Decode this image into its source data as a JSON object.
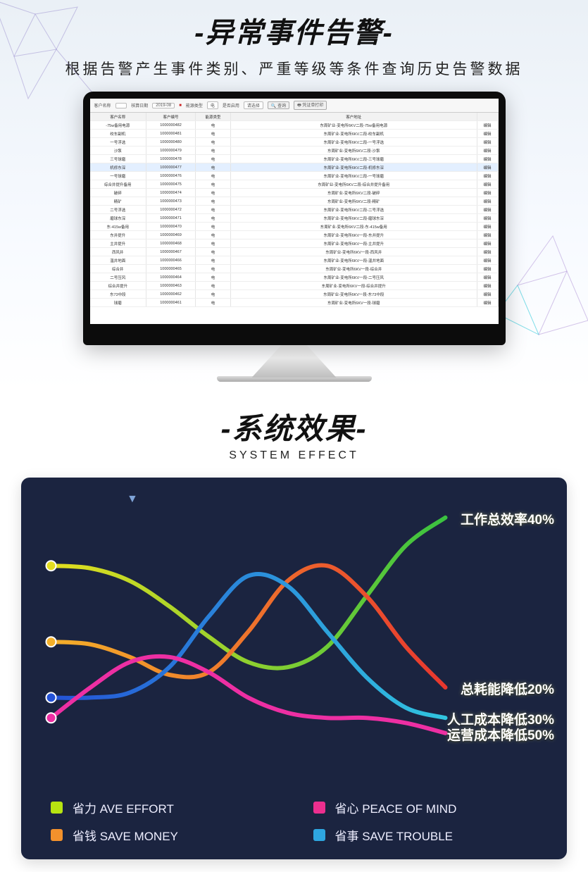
{
  "section1": {
    "title": "-异常事件告警-",
    "subtitle": "根据告警产生事件类别、严重等级等条件查询历史告警数据",
    "toolbar": {
      "name_label": "客户名称",
      "date_label": "核算日期",
      "date_value": "2019-08",
      "energy_label": "能源类型",
      "energy_value": "电",
      "use_label": "是否启用",
      "use_value": "请选择",
      "search_btn": "查询",
      "print_btn": "凭证单打印"
    },
    "columns": [
      "客户名称",
      "客户编号",
      "能源类型",
      "客户地址",
      ""
    ],
    "rows": [
      {
        "name": "-75w备用电源",
        "code": "1000000482",
        "type": "电",
        "addr": "东周矿业-变电所6KV二段-75w备用电源",
        "op": "编辑"
      },
      {
        "name": "绞车副机",
        "code": "1000000481",
        "type": "电",
        "addr": "东周矿业-变电所6KV二段-绞车副机",
        "op": "编辑"
      },
      {
        "name": "一号浮选",
        "code": "1000000480",
        "type": "电",
        "addr": "东周矿业-变电所6KV二段-一号浮选",
        "op": "编辑"
      },
      {
        "name": "沙泵",
        "code": "1000000479",
        "type": "电",
        "addr": "东周矿业-变电所6KV二段-沙泵",
        "op": "编辑"
      },
      {
        "name": "三号球磨",
        "code": "1000000478",
        "type": "电",
        "addr": "东周矿业-变电所6KV二段-三号球磨",
        "op": "编辑"
      },
      {
        "name": "机修东深",
        "code": "1000000477",
        "type": "电",
        "addr": "东周矿业-变电所6KV二段-机修东深",
        "op": "编辑",
        "sel": true
      },
      {
        "name": "一号球磨",
        "code": "1000000476",
        "type": "电",
        "addr": "东周矿业-变电所6KV二段-一号球磨",
        "op": "编辑"
      },
      {
        "name": "综合井提升备用",
        "code": "1000000475",
        "type": "电",
        "addr": "东周矿业-变电所6KV二段-综合井提升备用",
        "op": "编辑"
      },
      {
        "name": "破碎",
        "code": "1000000474",
        "type": "电",
        "addr": "东周矿业-变电所6KV二段-破碎",
        "op": "编辑"
      },
      {
        "name": "精矿",
        "code": "1000000473",
        "type": "电",
        "addr": "东周矿业-变电所6KV二段-精矿",
        "op": "编辑"
      },
      {
        "name": "二号浮选",
        "code": "1000000472",
        "type": "电",
        "addr": "东周矿业-变电所6KV二段-二号浮选",
        "op": "编辑"
      },
      {
        "name": "磨球东深",
        "code": "1000000471",
        "type": "电",
        "addr": "东周矿业-变电所6KV二段-磨球东深",
        "op": "编辑"
      },
      {
        "name": "东-415w备用",
        "code": "1000000470",
        "type": "电",
        "addr": "东周矿业-变电所6KV二段-东-415w备用",
        "op": "编辑"
      },
      {
        "name": "东井提升",
        "code": "1000000469",
        "type": "电",
        "addr": "东周矿业-变电所6KV一段-东井提升",
        "op": "编辑"
      },
      {
        "name": "主井提升",
        "code": "1000000468",
        "type": "电",
        "addr": "东周矿业-变电所6KV一段-主井提升",
        "op": "编辑"
      },
      {
        "name": "西风井",
        "code": "1000000467",
        "type": "电",
        "addr": "东周矿业-变电所6KV一段-西风井",
        "op": "编辑"
      },
      {
        "name": "温井地面",
        "code": "1000000466",
        "type": "电",
        "addr": "东周矿业-变电所6KV一段-温井地面",
        "op": "编辑"
      },
      {
        "name": "综合井",
        "code": "1000000465",
        "type": "电",
        "addr": "东周矿业-变电所6KV一段-综合井",
        "op": "编辑"
      },
      {
        "name": "二号压风",
        "code": "1000000464",
        "type": "电",
        "addr": "东周矿业-变电所6KV一段-二号压风",
        "op": "编辑"
      },
      {
        "name": "综合井提升",
        "code": "1000000463",
        "type": "电",
        "addr": "东周矿业-变电所6KV一段-综合井提升",
        "op": "编辑"
      },
      {
        "name": "东73中段",
        "code": "1000000462",
        "type": "电",
        "addr": "东周矿业-变电所6KV一段-东73中段",
        "op": "编辑"
      },
      {
        "name": "球磨",
        "code": "1000000461",
        "type": "电",
        "addr": "东周矿业-变电所6KV一段-球磨",
        "op": "编辑"
      }
    ]
  },
  "section2": {
    "title": "-系统效果-",
    "subtitle": "SYSTEM EFFECT",
    "legend": [
      {
        "label": "省力 AVE EFFORT",
        "color": "#b7e411"
      },
      {
        "label": "省心 PEACE OF MIND",
        "color": "#ec2f8f"
      },
      {
        "label": "省钱 SAVE MONEY",
        "color": "#f3912c"
      },
      {
        "label": "省事 SAVE TROUBLE",
        "color": "#2ea6e0"
      }
    ],
    "end_labels": [
      {
        "text": "工作总效率40%",
        "color": "#6fd33a"
      },
      {
        "text": "总耗能降低20%",
        "color": "#ef3f3f"
      },
      {
        "text": "人工成本降低30%",
        "color": "#2ea6e0"
      },
      {
        "text": "运营成本降低50%",
        "color": "#ec2f8f"
      }
    ],
    "marker": "▼"
  },
  "chart_data": {
    "type": "line",
    "title": "系统效果 (System Effect)",
    "note": "Curves are conceptual; no numeric axes shown. End-of-line labels summarize each curve's claim.",
    "x": [
      0,
      1,
      2,
      3,
      4,
      5,
      6,
      7,
      8,
      9,
      10
    ],
    "series": [
      {
        "name": "省力 AVE EFFORT / 工作总效率40%",
        "color_start": "#e4de1f",
        "color_end": "#3ac240",
        "end_label": "工作总效率40%",
        "values": [
          78,
          77,
          72,
          62,
          50,
          40,
          38,
          46,
          66,
          86,
          97
        ]
      },
      {
        "name": "省钱 SAVE MONEY / 总耗能降低20%",
        "color_start": "#f4b02a",
        "color_end": "#e8372e",
        "end_label": "总耗能降低20%",
        "values": [
          48,
          47,
          42,
          35,
          36,
          52,
          72,
          78,
          66,
          46,
          30
        ]
      },
      {
        "name": "省事 SAVE TROUBLE / 人工成本降低30%",
        "color_start": "#2452d6",
        "color_end": "#31c5df",
        "end_label": "人工成本降低30%",
        "values": [
          26,
          26,
          28,
          38,
          58,
          74,
          70,
          52,
          34,
          22,
          18
        ]
      },
      {
        "name": "省心 PEACE OF MIND / 运营成本降低50%",
        "color_start": "#ed2fa3",
        "color_end": "#ed2fa3",
        "end_label": "运营成本降低50%",
        "values": [
          18,
          30,
          40,
          42,
          36,
          26,
          20,
          18,
          18,
          16,
          12
        ]
      }
    ],
    "ylim": [
      0,
      100
    ],
    "axes_visible": false,
    "legend_position": "bottom"
  }
}
